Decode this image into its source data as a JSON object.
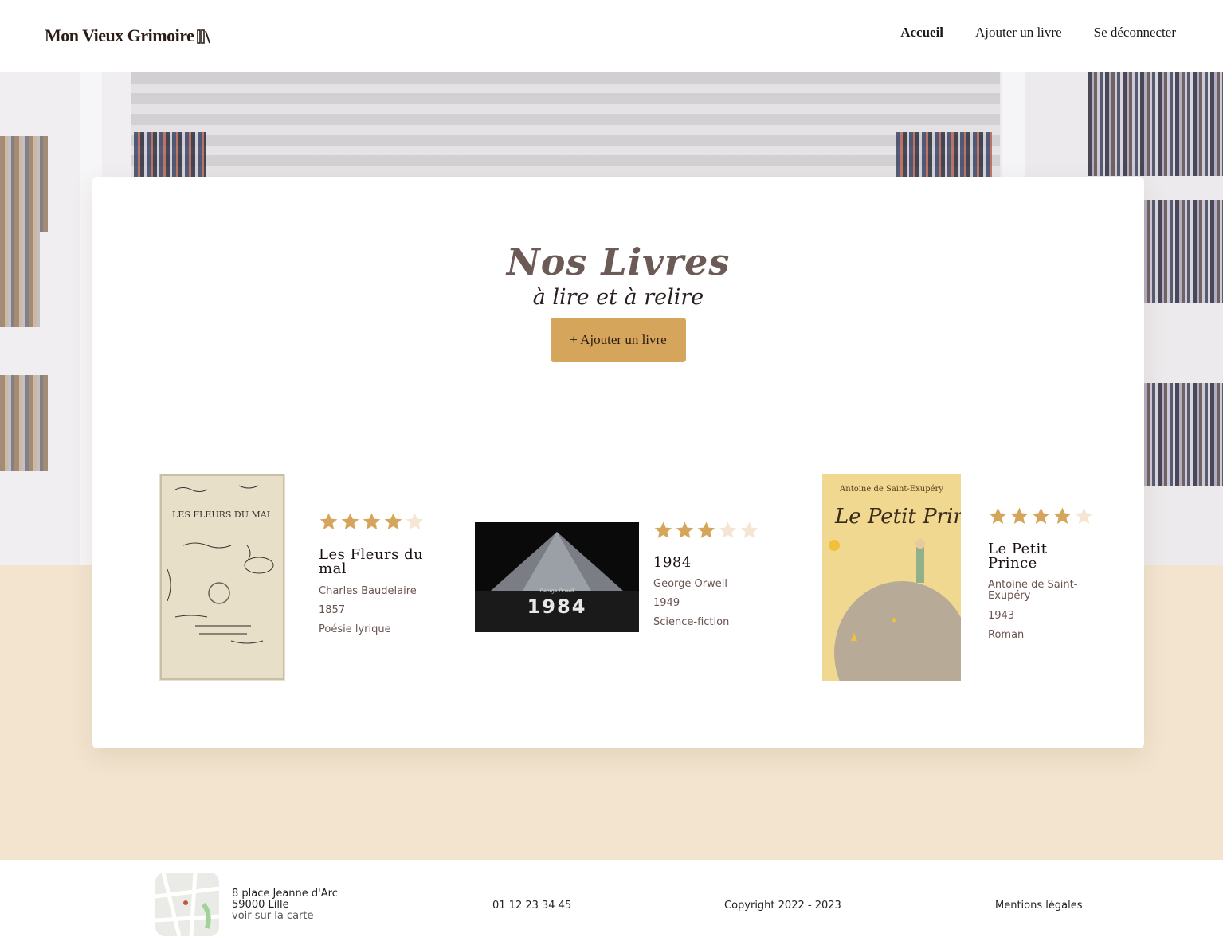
{
  "header": {
    "logo_text": "Mon Vieux Grimoire",
    "nav": [
      {
        "label": "Accueil",
        "active": true
      },
      {
        "label": "Ajouter un livre",
        "active": false
      },
      {
        "label": "Se déconnecter",
        "active": false
      }
    ]
  },
  "main": {
    "title": "Nos Livres",
    "subtitle": "à lire et à relire",
    "add_button": "+ Ajouter un livre",
    "accent_color": "#d6a55c"
  },
  "books": [
    {
      "title": "Les Fleurs du mal",
      "author": "Charles Baudelaire",
      "year": "1857",
      "genre": "Poésie lyrique",
      "rating": 4,
      "cover_title": "LES FLEURS DU MAL"
    },
    {
      "title": "1984",
      "author": "George Orwell",
      "year": "1949",
      "genre": "Science-fiction",
      "rating": 3,
      "cover_title": "1984",
      "cover_author": "George Orwell"
    },
    {
      "title": "Le Petit Prince",
      "author": "Antoine de Saint-Exupéry",
      "year": "1943",
      "genre": "Roman",
      "rating": 4,
      "cover_author": "Antoine de Saint-Exupéry",
      "cover_title": "Le Petit Prince"
    }
  ],
  "footer": {
    "address_line1": "8 place Jeanne d'Arc",
    "address_line2": "59000 Lille",
    "map_link": "voir sur la carte",
    "phone": "01 12 23 34 45",
    "copyright": "Copyright 2022 - 2023",
    "legal": "Mentions légales"
  }
}
